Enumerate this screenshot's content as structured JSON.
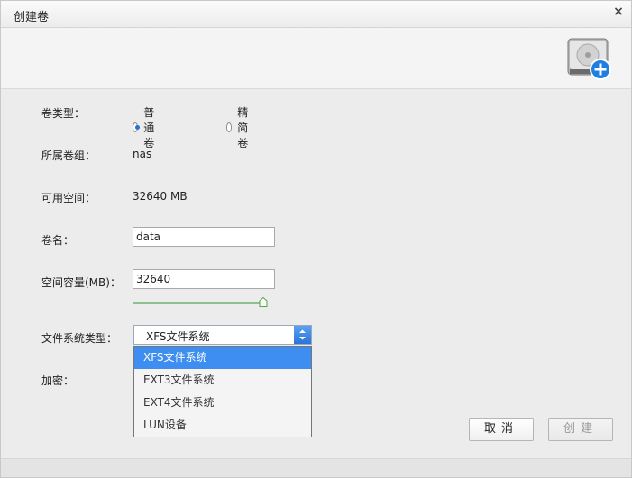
{
  "dialog": {
    "title": "创建卷",
    "close_label": "×"
  },
  "form": {
    "volume_type": {
      "label": "卷类型：",
      "options": [
        "普通卷",
        "精简卷"
      ],
      "selected": "普通卷"
    },
    "volume_group": {
      "label": "所属卷组：",
      "value": "nas"
    },
    "available_space": {
      "label": "可用空间：",
      "value": "32640 MB"
    },
    "volume_name": {
      "label": "卷名：",
      "value": "data"
    },
    "capacity": {
      "label": "空间容量(MB)：",
      "value": "32640",
      "slider_fraction": 1.0
    },
    "filesystem": {
      "label": "文件系统类型：",
      "selected": "XFS文件系统",
      "options": [
        "XFS文件系统",
        "EXT3文件系统",
        "EXT4文件系统",
        "LUN设备"
      ]
    },
    "encryption": {
      "label": "加密："
    }
  },
  "buttons": {
    "cancel": "取消",
    "create": "创建"
  },
  "colors": {
    "accent": "#3d8ef0",
    "slider": "#8fc08f",
    "icon_plus": "#1e7fe0"
  }
}
